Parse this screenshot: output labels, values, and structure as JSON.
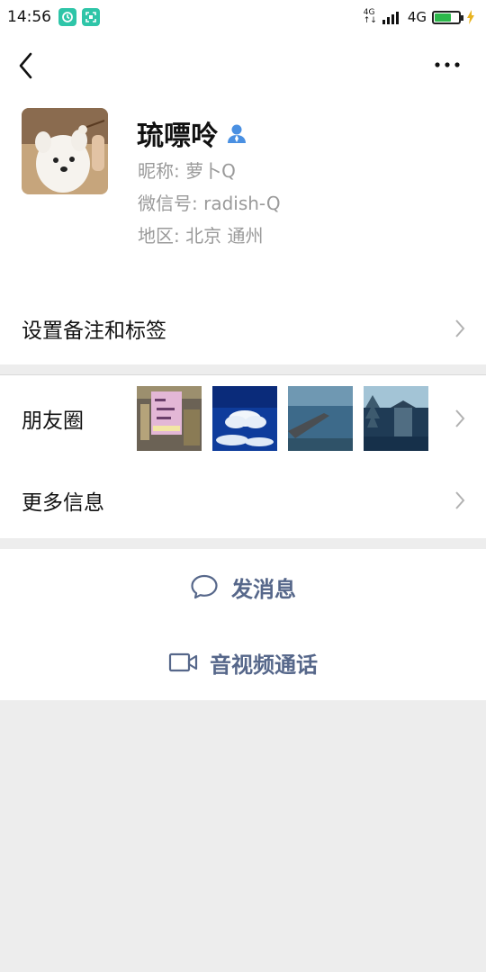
{
  "status_bar": {
    "time": "14:56",
    "network_top": "4G",
    "network_label": "4G",
    "battery_level": 0.7,
    "colors": {
      "app_icon": "#2ec5a8",
      "battery": "#2cb84b"
    }
  },
  "nav": {
    "back_icon": "chevron-left-icon",
    "more_icon": "more-dots-icon"
  },
  "profile": {
    "name": "琉嘌呤",
    "nickname": "昵称:  萝卜Q",
    "wechat_id": "微信号:  radish-Q",
    "region": "地区:  北京  通州",
    "badge_color": "#4a90e2"
  },
  "rows": {
    "remark_label": "设置备注和标签",
    "moments_label": "朋友圈",
    "more_info_label": "更多信息"
  },
  "actions": {
    "message_label": "发消息",
    "call_label": "音视频通话",
    "action_color": "#56678a"
  }
}
